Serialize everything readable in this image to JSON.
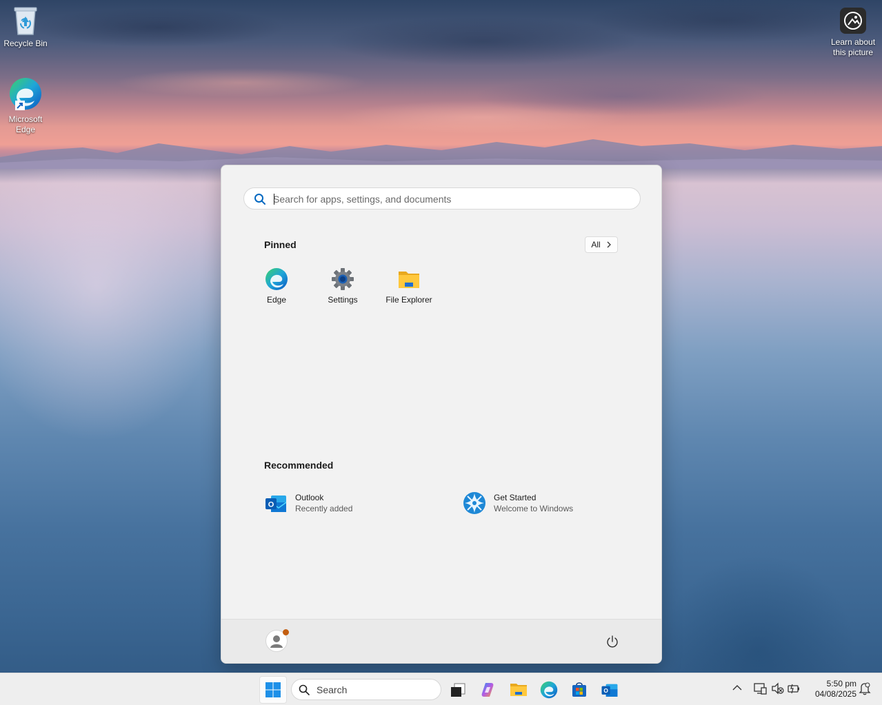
{
  "desktop": {
    "icons": [
      {
        "label": "Recycle Bin",
        "icon": "recycle-bin-icon"
      },
      {
        "label": "Microsoft Edge",
        "icon": "edge-icon"
      }
    ],
    "spotlight": {
      "label": "Learn about this picture",
      "icon": "spotlight-icon"
    }
  },
  "start_menu": {
    "search": {
      "placeholder": "Search for apps, settings, and documents"
    },
    "pinned": {
      "title": "Pinned",
      "all_label": "All",
      "items": [
        {
          "label": "Edge",
          "icon": "edge-icon"
        },
        {
          "label": "Settings",
          "icon": "settings-gear-icon"
        },
        {
          "label": "File Explorer",
          "icon": "folder-icon"
        }
      ]
    },
    "recommended": {
      "title": "Recommended",
      "items": [
        {
          "title": "Outlook",
          "subtitle": "Recently added",
          "icon": "outlook-icon"
        },
        {
          "title": "Get Started",
          "subtitle": "Welcome to Windows",
          "icon": "get-started-icon"
        }
      ]
    },
    "footer": {
      "user_icon": "user-avatar-icon",
      "power_icon": "power-icon"
    }
  },
  "taskbar": {
    "search_label": "Search",
    "apps": [
      "start-icon",
      "task-view-icon",
      "copilot-icon",
      "file-explorer-icon",
      "edge-icon",
      "store-icon",
      "outlook-icon"
    ],
    "tray_icons": [
      "chevron-up-icon",
      "network-icon",
      "volume-muted-icon",
      "battery-icon",
      "notification-icon"
    ],
    "time": "5:50 pm",
    "date": "04/08/2025"
  },
  "colors": {
    "accent": "#0067c0",
    "edge_blue": "#0c7bd6",
    "edge_green": "#5ad16b",
    "folder_yellow": "#ffc83d",
    "outlook_blue": "#0a5eb5",
    "notification_dot": "#c35e10"
  }
}
